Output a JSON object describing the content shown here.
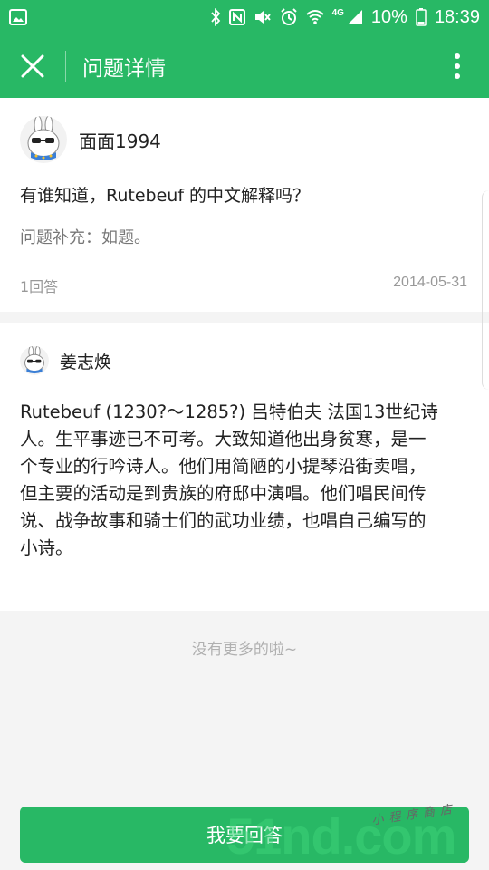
{
  "status_bar": {
    "network_type": "4G",
    "battery": "10%",
    "time": "18:39",
    "icons": [
      "gallery-icon",
      "bluetooth-icon",
      "nfc-icon",
      "mute-icon",
      "alarm-icon",
      "wifi-icon",
      "signal-icon",
      "battery-icon"
    ]
  },
  "app_bar": {
    "title": "问题详情",
    "close_icon": "close-icon",
    "more_icon": "more-vertical-icon"
  },
  "question": {
    "asker": "面面1994",
    "title": "有谁知道，Rutebeuf 的中文解释吗？",
    "supplement": "问题补充：如题。",
    "answer_count": "1回答",
    "date": "2014-05-31"
  },
  "answer": {
    "author": "姜志焕",
    "lines": [
      "Rutebeuf (1230?～1285?) 吕特伯夫 法国13世纪诗",
      "人。生平事迹已不可考。大致知道他出身贫寒，是一",
      "个专业的行吟诗人。他们用简陋的小提琴沿街卖唱，",
      "但主要的活动是到贵族的府邸中演唱。他们唱民间传",
      "说、战争故事和骑士们的武功业绩，也唱自己编写的",
      "小诗。"
    ]
  },
  "footer": {
    "no_more": "没有更多的啦~",
    "answer_button": "我要回答"
  },
  "watermark": {
    "big": "51nd.com",
    "small": "小程序商店"
  },
  "colors": {
    "accent": "#28b865",
    "text_primary": "#222222",
    "text_secondary": "#777777",
    "text_muted": "#999999",
    "background": "#f4f4f4"
  }
}
